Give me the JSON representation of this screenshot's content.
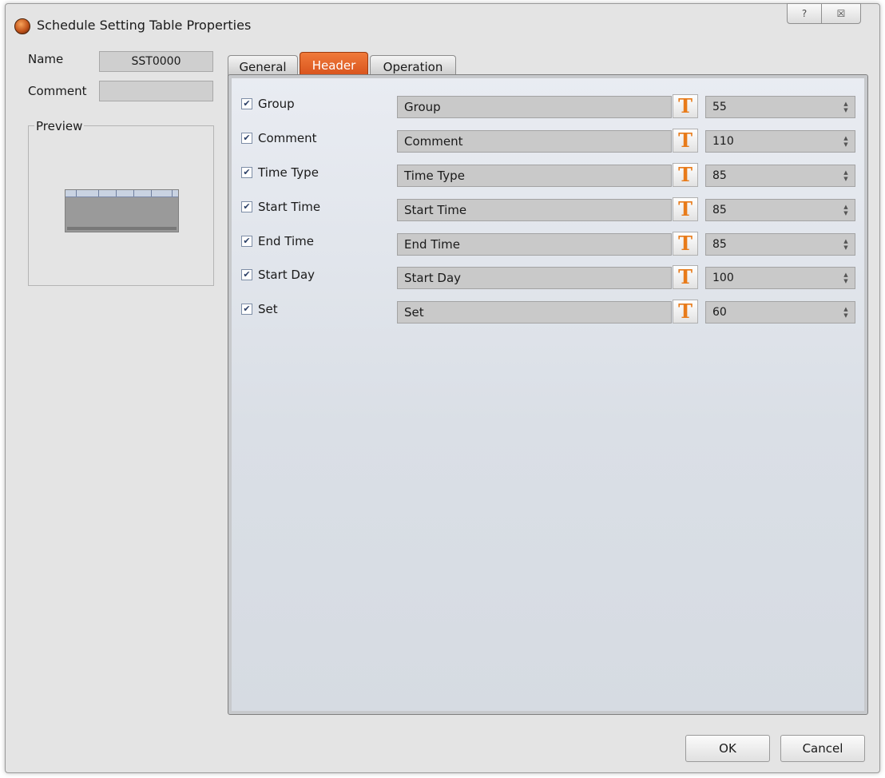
{
  "window": {
    "title": "Schedule Setting Table Properties",
    "help_glyph": "?",
    "close_glyph": "☒"
  },
  "left": {
    "name_label": "Name",
    "name_value": "SST0000",
    "comment_label": "Comment",
    "comment_value": "",
    "preview_label": "Preview"
  },
  "tabs": [
    {
      "label": "General",
      "active": false
    },
    {
      "label": "Header",
      "active": true
    },
    {
      "label": "Operation",
      "active": false
    }
  ],
  "rows": [
    {
      "label": "Group",
      "checked": true,
      "header_text": "Group",
      "width": "55"
    },
    {
      "label": "Comment",
      "checked": true,
      "header_text": "Comment",
      "width": "110"
    },
    {
      "label": "Time Type",
      "checked": true,
      "header_text": "Time Type",
      "width": "85"
    },
    {
      "label": "Start Time",
      "checked": true,
      "header_text": "Start Time",
      "width": "85"
    },
    {
      "label": "End Time",
      "checked": true,
      "header_text": "End Time",
      "width": "85"
    },
    {
      "label": "Start Day",
      "checked": true,
      "header_text": "Start Day",
      "width": "100"
    },
    {
      "label": "Set",
      "checked": true,
      "header_text": "Set",
      "width": "60"
    }
  ],
  "font_button_glyph": "T",
  "buttons": {
    "ok": "OK",
    "cancel": "Cancel"
  },
  "colors": {
    "active_tab": "#e8642a",
    "font_icon": "#e87b1a"
  }
}
